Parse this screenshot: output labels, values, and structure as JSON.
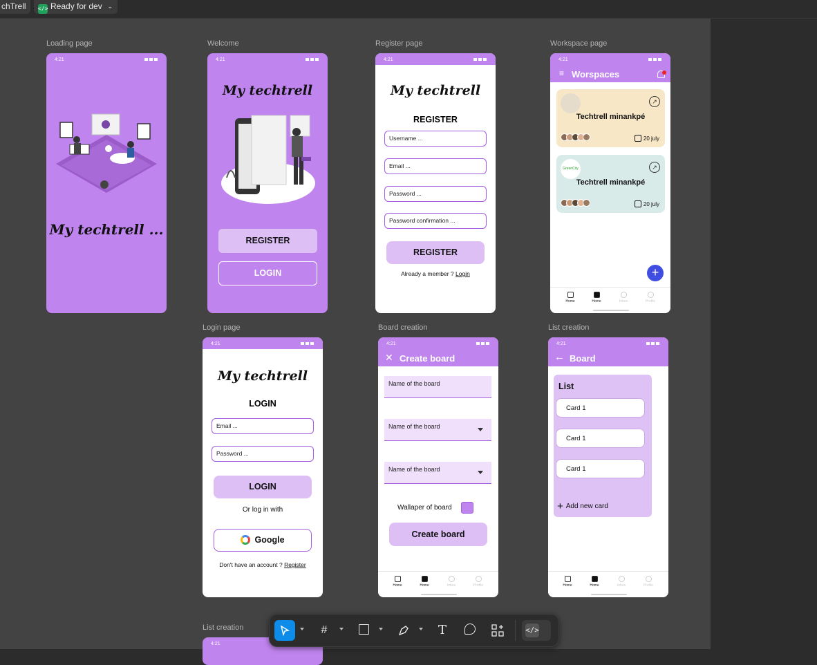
{
  "topbar": {
    "file_name": "chTrell",
    "dev_status": "Ready for dev"
  },
  "frames": {
    "loading": {
      "label": "Loading page",
      "time": "4:21",
      "brand": "My techtrell ..."
    },
    "welcome": {
      "label": "Welcome",
      "time": "4:21",
      "brand": "My techtrell",
      "register": "REGISTER",
      "login": "LOGIN"
    },
    "register": {
      "label": "Register page",
      "time": "4:21",
      "brand": "My techtrell",
      "heading": "REGISTER",
      "fields": [
        "Username ...",
        "Email ...",
        "Password ...",
        "Password confirmation ..."
      ],
      "submit": "REGISTER",
      "member_text": "Already a member ?",
      "login_link": "Login"
    },
    "workspace": {
      "label": "Workspace page",
      "time": "4:21",
      "title": "Worspaces",
      "cards": [
        {
          "title": "Techtrell minankpé",
          "date": "20 july",
          "color": "#f7e7c6"
        },
        {
          "title": "Techtrell minankpé",
          "date": "20 july",
          "color": "#d9ebe8",
          "logo_text": "GreenCity"
        }
      ],
      "fab": "+",
      "nav": [
        "Home",
        "Home",
        "Inbox",
        "Profile"
      ]
    },
    "login": {
      "label": "Login page",
      "time": "4:21",
      "brand": "My techtrell",
      "heading": "LOGIN",
      "fields": [
        "Email ...",
        "Password ..."
      ],
      "submit": "LOGIN",
      "or_text": "Or log in with",
      "google": "Google",
      "no_account": "Don't have an account ?",
      "register_link": "Register"
    },
    "board": {
      "label": "Board creation",
      "time": "4:21",
      "title": "Create board",
      "inputs": [
        "Name of the board",
        "Name of the board",
        "Name of the board"
      ],
      "wallpaper_label": "Wallaper of board",
      "wallpaper_color": "#c084ef",
      "submit": "Create board",
      "nav": [
        "Home",
        "Home",
        "Inbox",
        "Profile"
      ]
    },
    "list": {
      "label": "List creation",
      "time": "4:21",
      "title": "Board",
      "list_title": "List",
      "cards": [
        "Card 1",
        "Card 1",
        "Card 1"
      ],
      "add_card": "Add new card",
      "nav": [
        "Home",
        "Home",
        "Inbox",
        "Profile"
      ]
    },
    "list2": {
      "label": "List creation",
      "time": "4:21"
    }
  },
  "colors": {
    "accent": "#c084ef",
    "accent_light": "#dfc2f5",
    "fab": "#3f4de0",
    "canvas": "#434343"
  },
  "toolbar": {
    "tools": [
      "move-tool",
      "frame-tool",
      "shape-tool",
      "pen-tool",
      "text-tool",
      "comment-tool",
      "components-tool",
      "dev-mode-toggle"
    ]
  }
}
